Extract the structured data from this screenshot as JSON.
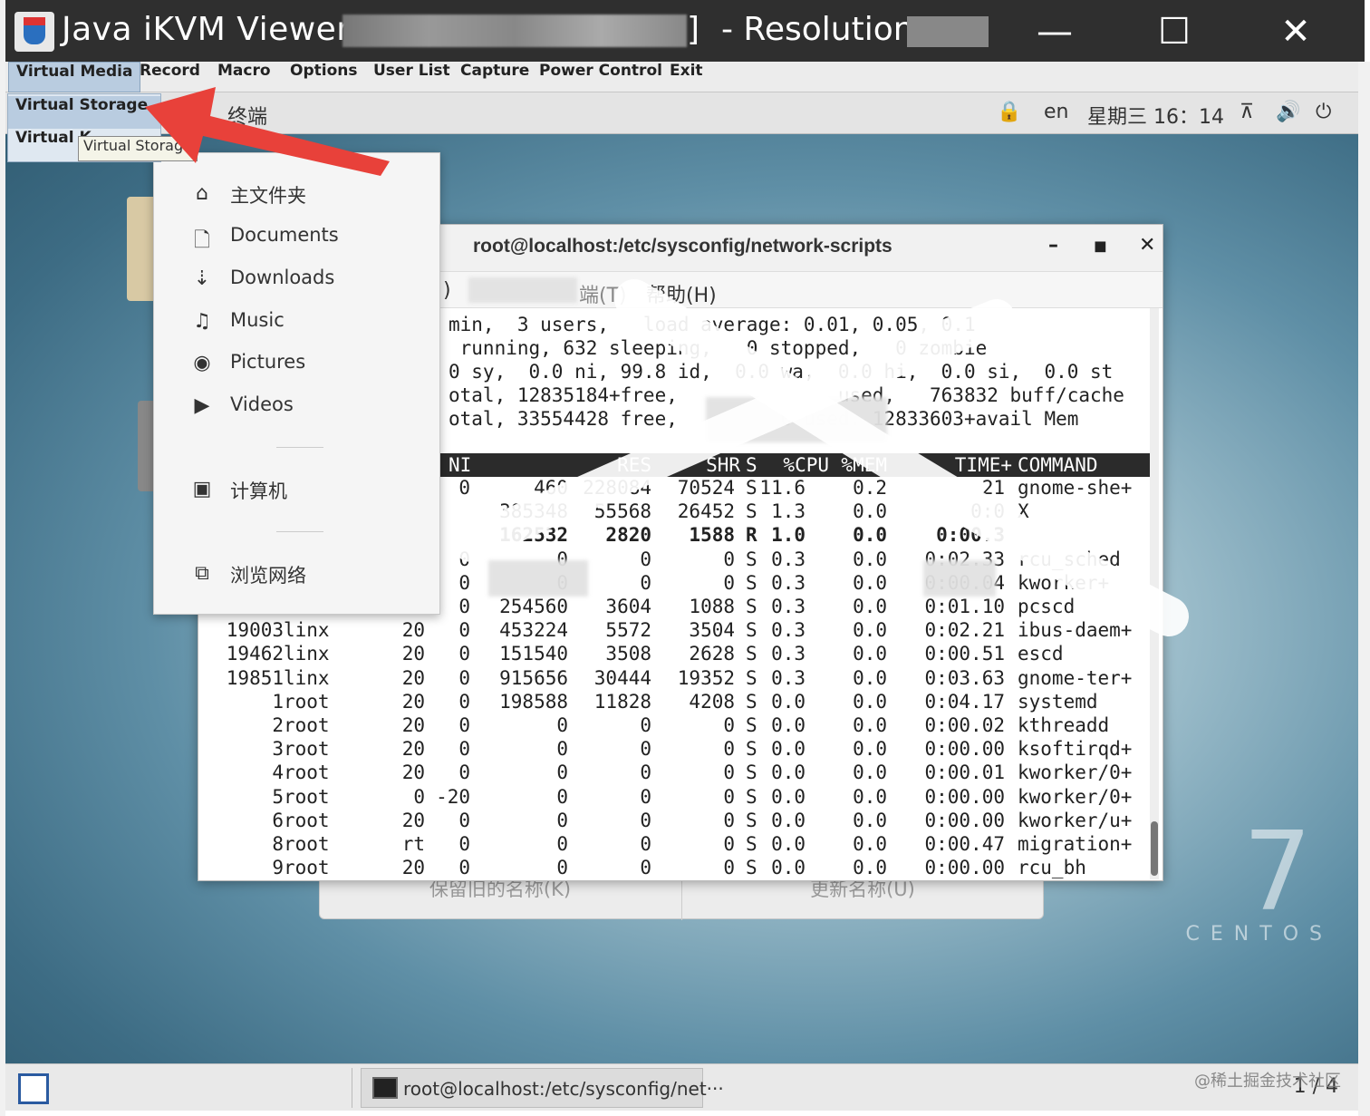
{
  "window": {
    "title": "Java iKVM Viewer v",
    "bracket": "]",
    "resolution_label": "- Resolution",
    "minimize": "—",
    "maximize": "☐",
    "close": "✕"
  },
  "menubar": [
    "Virtual Media",
    "Record",
    "Macro",
    "Options",
    "User List",
    "Capture",
    "Power Control",
    "Exit"
  ],
  "java_dropdown": {
    "selected": "Virtual Storage",
    "sub": "Virtual K",
    "tooltip": "Virtual Storage"
  },
  "remote_topbar": {
    "app_label": "终端",
    "lang": "en",
    "datetime": "星期三 16：14"
  },
  "places_menu": {
    "items": [
      {
        "icon": "home-icon",
        "label": "主文件夹"
      },
      {
        "icon": "document-icon",
        "label": "Documents"
      },
      {
        "icon": "download-icon",
        "label": "Downloads"
      },
      {
        "icon": "music-icon",
        "label": "Music"
      },
      {
        "icon": "camera-icon",
        "label": "Pictures"
      },
      {
        "icon": "video-icon",
        "label": "Videos"
      },
      {
        "icon": "computer-icon",
        "label": "计算机"
      },
      {
        "icon": "network-icon",
        "label": "浏览网络"
      }
    ]
  },
  "terminal": {
    "title": "root@localhost:/etc/sysconfig/network-scripts",
    "menu": {
      "paren": ")",
      "terminal_partial": "端(T)",
      "help": "帮助(H)"
    },
    "summary": [
      "min,  3 users,   load average: 0.01, 0.05, 0.1",
      " running, 632 sleeping,   0 stopped,   0 zombie",
      "0 sy,  0.0 ni, 99.8 id,  0.0 wa,  0.0 hi,  0.0 si,  0.0 st",
      "otal, 12835184+free,              used,   763832 buff/cache",
      "otal, 33554428 free,         0 used. 12833603+avail Mem"
    ],
    "header": [
      "NI",
      "RES",
      "SHR",
      "S",
      "%CPU",
      "%MEM",
      "TIME+",
      "COMMAND"
    ],
    "rows": [
      {
        "pid": "",
        "user": "",
        "pr": "",
        "ni": "0",
        "virt": "460",
        "res": "228084",
        "shr": "70524",
        "s": "S",
        "cpu": "11.6",
        "mem": "0.2",
        "time": "21",
        "cmd": "gnome-she+"
      },
      {
        "pid": "",
        "user": "",
        "pr": "",
        "ni": "",
        "virt": "385348",
        "res": "55568",
        "shr": "26452",
        "s": "S",
        "cpu": "1.3",
        "mem": "0.0",
        "time": "0:0",
        "cmd": "X"
      },
      {
        "pid": "",
        "user": "",
        "pr": "",
        "ni": "",
        "virt": "162532",
        "res": "2820",
        "shr": "1588",
        "s": "R",
        "cpu": "1.0",
        "mem": "0.0",
        "time": "0:00.3",
        "cmd": ""
      },
      {
        "pid": "",
        "user": "",
        "pr": "",
        "ni": "0",
        "virt": "0",
        "res": "0",
        "shr": "0",
        "s": "S",
        "cpu": "0.3",
        "mem": "0.0",
        "time": "0:02.33",
        "cmd": "rcu_sched"
      },
      {
        "pid": "",
        "user": "",
        "pr": "",
        "ni": "0",
        "virt": "0",
        "res": "0",
        "shr": "0",
        "s": "S",
        "cpu": "0.3",
        "mem": "0.0",
        "time": "0:00.04",
        "cmd": "kworker+"
      },
      {
        "pid": "",
        "user": "",
        "pr": "",
        "ni": "0",
        "virt": "254560",
        "res": "3604",
        "shr": "1088",
        "s": "S",
        "cpu": "0.3",
        "mem": "0.0",
        "time": "0:01.10",
        "cmd": "pcscd"
      },
      {
        "pid": "19003",
        "user": "linx",
        "pr": "20",
        "ni": "0",
        "virt": "453224",
        "res": "5572",
        "shr": "3504",
        "s": "S",
        "cpu": "0.3",
        "mem": "0.0",
        "time": "0:02.21",
        "cmd": "ibus-daem+"
      },
      {
        "pid": "19462",
        "user": "linx",
        "pr": "20",
        "ni": "0",
        "virt": "151540",
        "res": "3508",
        "shr": "2628",
        "s": "S",
        "cpu": "0.3",
        "mem": "0.0",
        "time": "0:00.51",
        "cmd": "escd"
      },
      {
        "pid": "19851",
        "user": "linx",
        "pr": "20",
        "ni": "0",
        "virt": "915656",
        "res": "30444",
        "shr": "19352",
        "s": "S",
        "cpu": "0.3",
        "mem": "0.0",
        "time": "0:03.63",
        "cmd": "gnome-ter+"
      },
      {
        "pid": "1",
        "user": "root",
        "pr": "20",
        "ni": "0",
        "virt": "198588",
        "res": "11828",
        "shr": "4208",
        "s": "S",
        "cpu": "0.0",
        "mem": "0.0",
        "time": "0:04.17",
        "cmd": "systemd"
      },
      {
        "pid": "2",
        "user": "root",
        "pr": "20",
        "ni": "0",
        "virt": "0",
        "res": "0",
        "shr": "0",
        "s": "S",
        "cpu": "0.0",
        "mem": "0.0",
        "time": "0:00.02",
        "cmd": "kthreadd"
      },
      {
        "pid": "3",
        "user": "root",
        "pr": "20",
        "ni": "0",
        "virt": "0",
        "res": "0",
        "shr": "0",
        "s": "S",
        "cpu": "0.0",
        "mem": "0.0",
        "time": "0:00.00",
        "cmd": "ksoftirqd+"
      },
      {
        "pid": "4",
        "user": "root",
        "pr": "20",
        "ni": "0",
        "virt": "0",
        "res": "0",
        "shr": "0",
        "s": "S",
        "cpu": "0.0",
        "mem": "0.0",
        "time": "0:00.01",
        "cmd": "kworker/0+"
      },
      {
        "pid": "5",
        "user": "root",
        "pr": "0",
        "ni": "-20",
        "virt": "0",
        "res": "0",
        "shr": "0",
        "s": "S",
        "cpu": "0.0",
        "mem": "0.0",
        "time": "0:00.00",
        "cmd": "kworker/0+"
      },
      {
        "pid": "6",
        "user": "root",
        "pr": "20",
        "ni": "0",
        "virt": "0",
        "res": "0",
        "shr": "0",
        "s": "S",
        "cpu": "0.0",
        "mem": "0.0",
        "time": "0:00.00",
        "cmd": "kworker/u+"
      },
      {
        "pid": "8",
        "user": "root",
        "pr": "rt",
        "ni": "0",
        "virt": "0",
        "res": "0",
        "shr": "0",
        "s": "S",
        "cpu": "0.0",
        "mem": "0.0",
        "time": "0:00.47",
        "cmd": "migration+"
      },
      {
        "pid": "9",
        "user": "root",
        "pr": "20",
        "ni": "0",
        "virt": "0",
        "res": "0",
        "shr": "0",
        "s": "S",
        "cpu": "0.0",
        "mem": "0.0",
        "time": "0:00.00",
        "cmd": "rcu_bh"
      }
    ]
  },
  "bg_dialog": {
    "keep_old": "保留旧的名称(K)",
    "update": "更新名称(U)"
  },
  "desktop_brand": {
    "number": "7",
    "word": "CENTOS"
  },
  "taskbar": {
    "task_label": "root@localhost:/etc/sysconfig/net···",
    "page": "1 / 4"
  },
  "watermark": "@稀土掘金技术社区",
  "colors": {
    "arrow": "#e8413a",
    "titlebar": "#2f2f2f",
    "menu_selected": "#b9cce0"
  }
}
